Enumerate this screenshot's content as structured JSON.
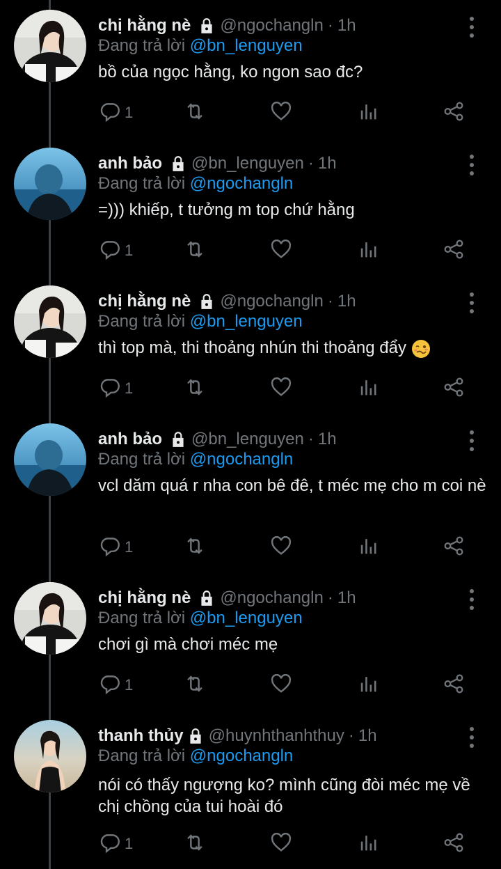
{
  "replying_to_label": "Đang trả lời",
  "tweets": [
    {
      "name": "chị hằng nè",
      "handle": "@ngochangln",
      "dot": "·",
      "time": "1h",
      "reply_to": "@bn_lenguyen",
      "text": "bồ của ngọc hằng, ko ngon sao đc?",
      "reply_count": "1",
      "avatar": "avatar-hang"
    },
    {
      "name": "anh bảo",
      "handle": "@bn_lenguyen",
      "dot": "·",
      "time": "1h",
      "reply_to": "@ngochangln",
      "text": "=))) khiếp, t tưởng m top chứ hằng",
      "reply_count": "1",
      "avatar": "avatar-bao"
    },
    {
      "name": "chị hằng nè",
      "handle": "@ngochangln",
      "dot": "·",
      "time": "1h",
      "reply_to": "@bn_lenguyen",
      "text": "thì top mà, thi thoảng nhún thi thoảng đẩy",
      "emoji": "woozy-face",
      "reply_count": "1",
      "avatar": "avatar-hang"
    },
    {
      "name": "anh bảo",
      "handle": "@bn_lenguyen",
      "dot": "·",
      "time": "1h",
      "reply_to": "@ngochangln",
      "text": "vcl dăm quá r nha con bê đê, t méc mẹ cho m coi nè",
      "reply_count": "1",
      "avatar": "avatar-bao"
    },
    {
      "name": "chị hằng nè",
      "handle": "@ngochangln",
      "dot": "·",
      "time": "1h",
      "reply_to": "@bn_lenguyen",
      "text": "chơi gì mà chơi méc mẹ",
      "reply_count": "1",
      "avatar": "avatar-hang"
    },
    {
      "name": "thanh thủy",
      "handle": "@huynhthanhthuy",
      "dot": "·",
      "time": "1h",
      "reply_to": "@ngochangln",
      "text": "nói có thấy ngượng ko? mình cũng đòi méc mẹ về chị chồng của tui hoài đó",
      "reply_count": "1",
      "avatar": "avatar-thuy"
    }
  ],
  "icons": {
    "reply": "reply-icon",
    "retweet": "retweet-icon",
    "like": "heart-icon",
    "views": "views-icon",
    "share": "share-icon",
    "lock": "lock-icon",
    "more": "more-icon"
  },
  "colors": {
    "background": "#000000",
    "text": "#e7e9ea",
    "muted": "#71767b",
    "link": "#1d9bf0"
  }
}
